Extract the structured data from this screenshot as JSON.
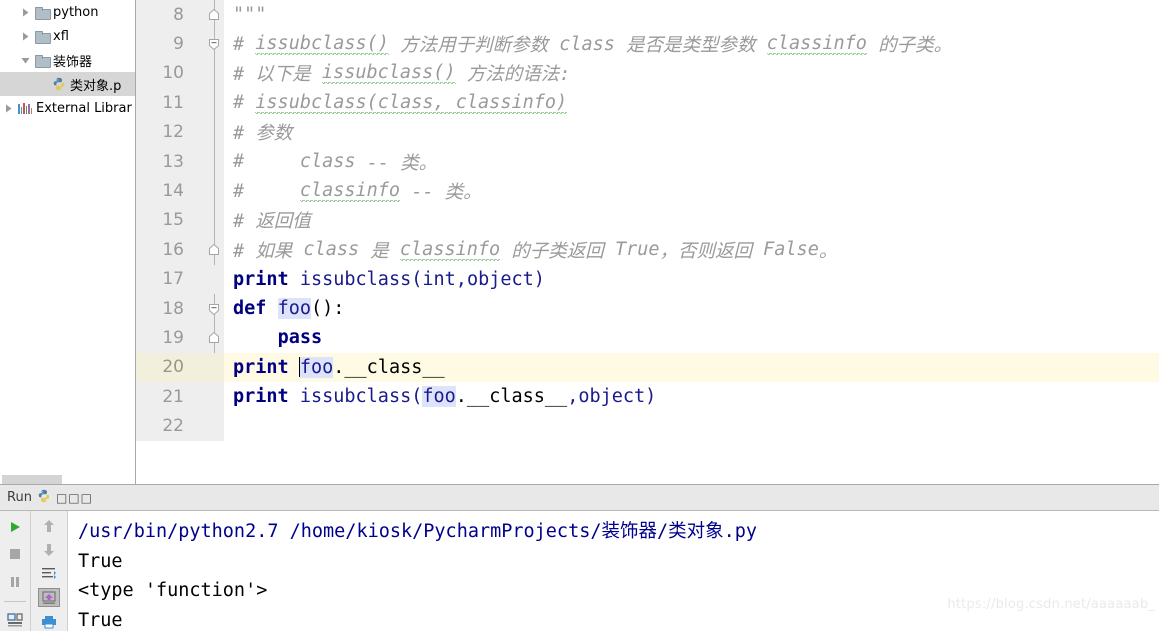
{
  "project_tree": {
    "name": "project-tree",
    "items": [
      {
        "label": "python",
        "icon": "folder-icon",
        "expanded": false,
        "indent": 1,
        "selected": false,
        "type": "folder"
      },
      {
        "label": "xfl",
        "icon": "folder-icon",
        "expanded": false,
        "indent": 1,
        "selected": false,
        "type": "folder"
      },
      {
        "label": "装饰器",
        "icon": "folder-icon",
        "expanded": true,
        "indent": 1,
        "selected": false,
        "type": "folder"
      },
      {
        "label": "类对象.p",
        "icon": "python-file-icon",
        "expanded": null,
        "indent": 2,
        "selected": true,
        "type": "file"
      },
      {
        "label": "External Librar",
        "icon": "external-libraries-icon",
        "expanded": false,
        "indent": 0,
        "selected": false,
        "type": "libraries"
      }
    ]
  },
  "editor": {
    "name": "code-editor",
    "language": "python",
    "current_line": 20,
    "first_visible_line": 8,
    "lines": [
      {
        "num": "8",
        "fold": "fold-end",
        "current": false,
        "tokens": [
          {
            "t": "\"\"\"",
            "k": "cm"
          }
        ]
      },
      {
        "num": "9",
        "fold": "fold-start",
        "current": false,
        "tokens": [
          {
            "t": "# ",
            "k": "cm"
          },
          {
            "t": "issubclass()",
            "k": "cm-squig"
          },
          {
            "t": " 方法用于判断参数 ",
            "k": "cm"
          },
          {
            "t": "class",
            "k": "cm"
          },
          {
            "t": " 是否是类型参数 ",
            "k": "cm"
          },
          {
            "t": "classinfo",
            "k": "cm-squig"
          },
          {
            "t": " 的子类。",
            "k": "cm"
          }
        ]
      },
      {
        "num": "10",
        "fold": "line",
        "current": false,
        "tokens": [
          {
            "t": "# 以下是 ",
            "k": "cm"
          },
          {
            "t": "issubclass()",
            "k": "cm-squig"
          },
          {
            "t": " 方法的语法:",
            "k": "cm"
          }
        ]
      },
      {
        "num": "11",
        "fold": "line",
        "current": false,
        "tokens": [
          {
            "t": "# ",
            "k": "cm"
          },
          {
            "t": "issubclass(class, classinfo)",
            "k": "cm-squig"
          }
        ]
      },
      {
        "num": "12",
        "fold": "line",
        "current": false,
        "tokens": [
          {
            "t": "# 参数",
            "k": "cm"
          }
        ]
      },
      {
        "num": "13",
        "fold": "line",
        "current": false,
        "tokens": [
          {
            "t": "#     ",
            "k": "cm"
          },
          {
            "t": "class",
            "k": "cm"
          },
          {
            "t": " -- 类。",
            "k": "cm"
          }
        ]
      },
      {
        "num": "14",
        "fold": "line",
        "current": false,
        "tokens": [
          {
            "t": "#     ",
            "k": "cm"
          },
          {
            "t": "classinfo",
            "k": "cm-squig"
          },
          {
            "t": " -- 类。",
            "k": "cm"
          }
        ]
      },
      {
        "num": "15",
        "fold": "line",
        "current": false,
        "tokens": [
          {
            "t": "# 返回值",
            "k": "cm"
          }
        ]
      },
      {
        "num": "16",
        "fold": "fold-end",
        "current": false,
        "tokens": [
          {
            "t": "# 如果 ",
            "k": "cm"
          },
          {
            "t": "class",
            "k": "cm"
          },
          {
            "t": " 是 ",
            "k": "cm"
          },
          {
            "t": "classinfo",
            "k": "cm-squig"
          },
          {
            "t": " 的子类返回 ",
            "k": "cm"
          },
          {
            "t": "True",
            "k": "cm"
          },
          {
            "t": "，否则返回 ",
            "k": "cm"
          },
          {
            "t": "False",
            "k": "cm"
          },
          {
            "t": "。",
            "k": "cm"
          }
        ]
      },
      {
        "num": "17",
        "fold": "none",
        "current": false,
        "tokens": [
          {
            "t": "print",
            "k": "kw"
          },
          {
            "t": " ",
            "k": "pl"
          },
          {
            "t": "issubclass",
            "k": "id"
          },
          {
            "t": "(",
            "k": "id"
          },
          {
            "t": "int",
            "k": "id"
          },
          {
            "t": ",",
            "k": "id"
          },
          {
            "t": "object",
            "k": "id"
          },
          {
            "t": ")",
            "k": "id"
          }
        ]
      },
      {
        "num": "18",
        "fold": "fold-start",
        "current": false,
        "tokens": [
          {
            "t": "def",
            "k": "kw"
          },
          {
            "t": " ",
            "k": "pl"
          },
          {
            "t": "foo",
            "k": "hl"
          },
          {
            "t": "():",
            "k": "pl"
          }
        ]
      },
      {
        "num": "19",
        "fold": "fold-end",
        "current": false,
        "tokens": [
          {
            "t": "    ",
            "k": "pl"
          },
          {
            "t": "pass",
            "k": "kw"
          }
        ]
      },
      {
        "num": "20",
        "fold": "none",
        "current": true,
        "tokens": [
          {
            "t": "print",
            "k": "kw"
          },
          {
            "t": " ",
            "k": "pl"
          },
          {
            "t": "|CARET|",
            "k": "caret"
          },
          {
            "t": "foo",
            "k": "hl"
          },
          {
            "t": ".__class__",
            "k": "pl"
          }
        ]
      },
      {
        "num": "21",
        "fold": "none",
        "current": false,
        "tokens": [
          {
            "t": "print",
            "k": "kw"
          },
          {
            "t": " ",
            "k": "pl"
          },
          {
            "t": "issubclass",
            "k": "id"
          },
          {
            "t": "(",
            "k": "id"
          },
          {
            "t": "foo",
            "k": "hl"
          },
          {
            "t": ".__class__",
            "k": "pl"
          },
          {
            "t": ",",
            "k": "id"
          },
          {
            "t": "object",
            "k": "id"
          },
          {
            "t": ")",
            "k": "id"
          }
        ]
      },
      {
        "num": "22",
        "fold": "none",
        "current": false,
        "tokens": []
      }
    ]
  },
  "run_panel": {
    "tab_label": "Run",
    "tab_icon": "python-icon",
    "tab_config_name": "□□□",
    "toolbar_left": [
      {
        "name": "rerun-button",
        "icon": "play-icon"
      },
      {
        "name": "stop-button",
        "icon": "stop-icon"
      },
      {
        "name": "pause-button",
        "icon": "pause-icon"
      },
      {
        "name": "layout-button",
        "icon": "layout-icon"
      }
    ],
    "toolbar_right": [
      {
        "name": "up-button",
        "icon": "arrow-up-icon",
        "pressed": false
      },
      {
        "name": "down-button",
        "icon": "arrow-down-icon",
        "pressed": false
      },
      {
        "name": "soft-wrap-button",
        "icon": "soft-wrap-icon",
        "pressed": false
      },
      {
        "name": "scroll-to-end-button",
        "icon": "scroll-to-end-icon",
        "pressed": true
      },
      {
        "name": "print-button",
        "icon": "print-icon",
        "pressed": false
      }
    ],
    "console_lines": [
      {
        "text": "/usr/bin/python2.7 /home/kiosk/PycharmProjects/装饰器/类对象.py",
        "style": "command"
      },
      {
        "text": "True",
        "style": "output"
      },
      {
        "text": "<type 'function'>",
        "style": "output"
      },
      {
        "text": "True",
        "style": "output"
      }
    ]
  },
  "watermark": {
    "text": "https://blog.csdn.net/aaaaaab_"
  }
}
